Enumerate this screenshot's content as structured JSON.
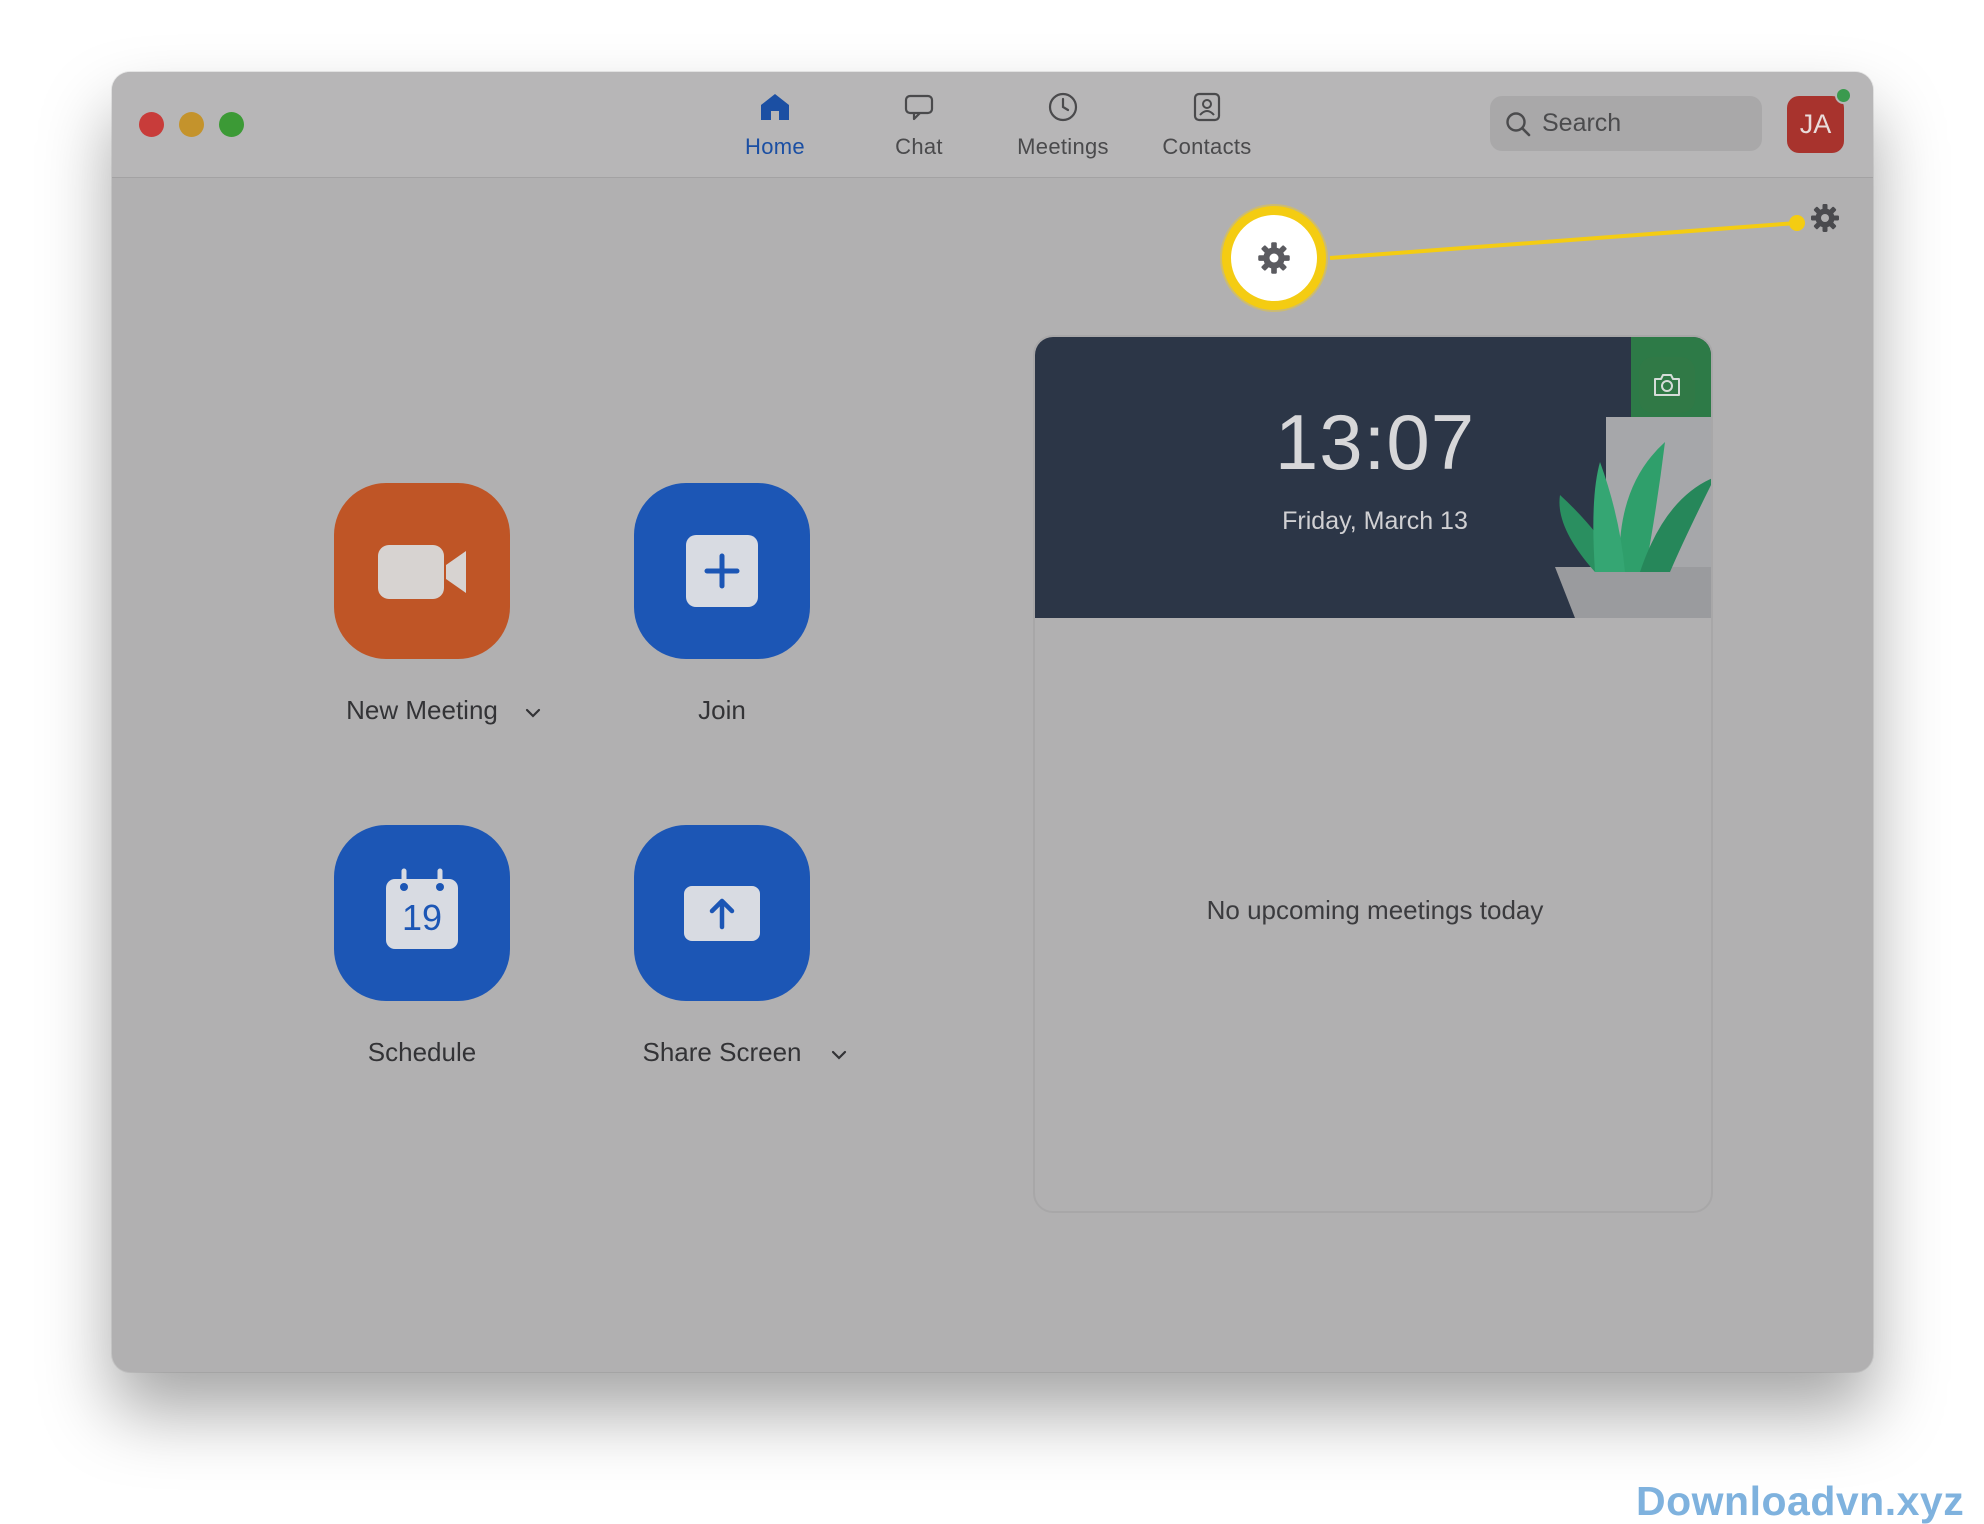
{
  "window": {
    "nav": {
      "tabs": [
        {
          "label": "Home",
          "icon": "home-icon",
          "active": true
        },
        {
          "label": "Chat",
          "icon": "chat-bubble-icon",
          "active": false
        },
        {
          "label": "Meetings",
          "icon": "clock-icon",
          "active": false
        },
        {
          "label": "Contacts",
          "icon": "contact-card-icon",
          "active": false
        }
      ]
    },
    "search": {
      "placeholder": "Search",
      "icon": "search-icon"
    },
    "avatar": {
      "initials": "JA",
      "color": "#a8332d",
      "status": "online"
    },
    "settings_icon": "gear-icon"
  },
  "callout": {
    "icon": "gear-icon",
    "color": "#f4cc12"
  },
  "actions": [
    {
      "label": "New Meeting",
      "icon": "video-camera-icon",
      "color": "#bf5526",
      "has_dropdown": true
    },
    {
      "label": "Join",
      "icon": "plus-icon",
      "color": "#1c56b5",
      "has_dropdown": false
    },
    {
      "label": "Schedule",
      "icon": "calendar-icon",
      "calendar_day": "19",
      "color": "#1c56b5",
      "has_dropdown": false
    },
    {
      "label": "Share Screen",
      "icon": "upload-arrow-icon",
      "color": "#1c56b5",
      "has_dropdown": true
    }
  ],
  "meetings_panel": {
    "time": "13:07",
    "date": "Friday, March 13",
    "empty_message": "No upcoming meetings today",
    "camera_icon": "camera-icon"
  },
  "watermark": "Downloadvn.xyz"
}
